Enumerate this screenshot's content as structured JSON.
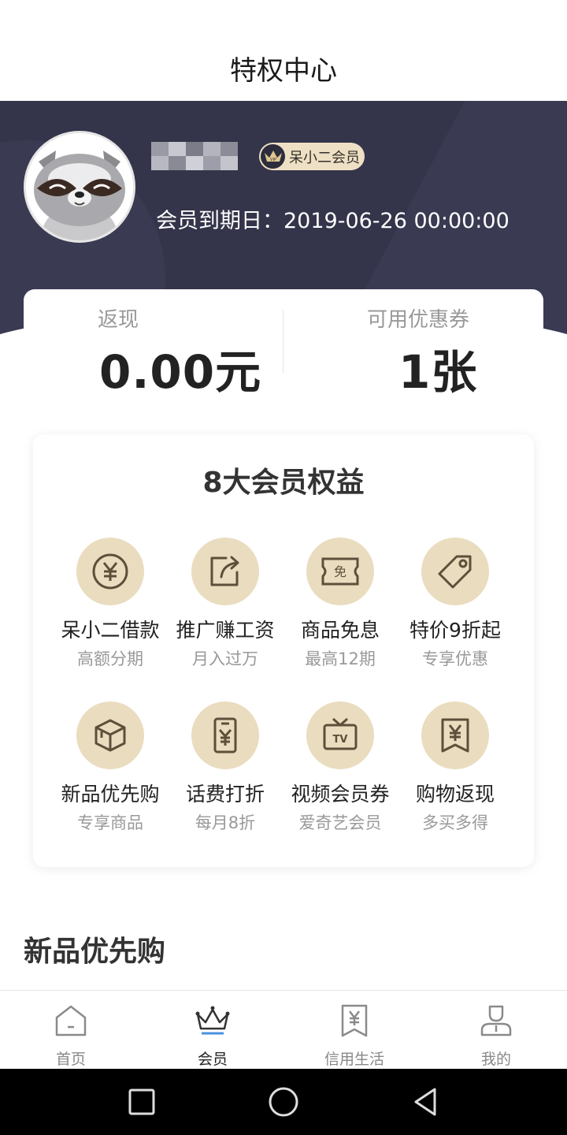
{
  "header": {
    "title": "特权中心"
  },
  "profile": {
    "vip_label": "呆小二会员",
    "vip_icon_text": "VIP",
    "expire_text": "会员到期日：2019-06-26 00:00:00"
  },
  "stats": {
    "cashback_label": "返现",
    "cashback_value": "0.00元",
    "coupon_label": "可用优惠券",
    "coupon_value": "1张"
  },
  "benefits": {
    "title": "8大会员权益",
    "items": [
      {
        "name": "呆小二借款",
        "sub": "高额分期",
        "icon": "yen-circle-icon"
      },
      {
        "name": "推广赚工资",
        "sub": "月入过万",
        "icon": "share-icon"
      },
      {
        "name": "商品免息",
        "sub": "最高12期",
        "icon": "ticket-free-icon",
        "icon_text": "免"
      },
      {
        "name": "特价9折起",
        "sub": "专享优惠",
        "icon": "tag-icon"
      },
      {
        "name": "新品优先购",
        "sub": "专享商品",
        "icon": "box-icon"
      },
      {
        "name": "话费打折",
        "sub": "每月8折",
        "icon": "phone-yen-icon"
      },
      {
        "name": "视频会员券",
        "sub": "爱奇艺会员",
        "icon": "tv-icon",
        "icon_text": "TV"
      },
      {
        "name": "购物返现",
        "sub": "多买多得",
        "icon": "receipt-yen-icon"
      }
    ]
  },
  "section": {
    "title": "新品优先购"
  },
  "tabbar": {
    "items": [
      {
        "label": "首页",
        "icon": "home-icon"
      },
      {
        "label": "会员",
        "icon": "crown-icon",
        "active": true
      },
      {
        "label": "信用生活",
        "icon": "bookmark-yen-icon"
      },
      {
        "label": "我的",
        "icon": "user-icon"
      }
    ]
  },
  "colors": {
    "hero_bg": "#34344a",
    "benefit_circle": "#eadcbf",
    "icon_stroke": "#5e4f3b",
    "vip_badge": "#eee0c4",
    "active_accent": "#4a90e2"
  }
}
